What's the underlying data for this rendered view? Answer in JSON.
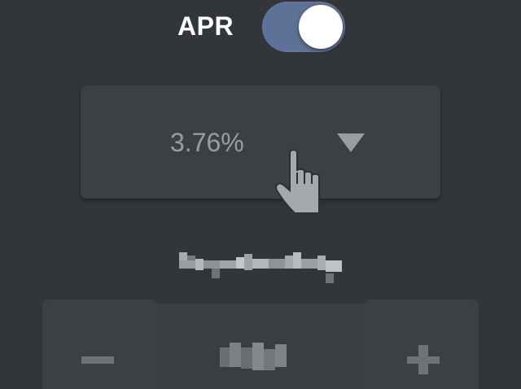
{
  "apr_toggle": {
    "label": "APR",
    "state": "on",
    "track_color": "#5e7196",
    "knob_color": "#ffffff"
  },
  "rate_select": {
    "value": "3.76%",
    "caret_icon": "caret-down-icon"
  },
  "cursor": {
    "icon": "hand-pointer-icon"
  },
  "payment_label": {
    "text": ""
  },
  "stepper": {
    "minus_icon": "minus-icon",
    "plus_icon": "plus-icon",
    "value": ""
  },
  "colors": {
    "background": "#32363a",
    "surface": "#3c4044",
    "muted_text": "#9a9da0"
  }
}
